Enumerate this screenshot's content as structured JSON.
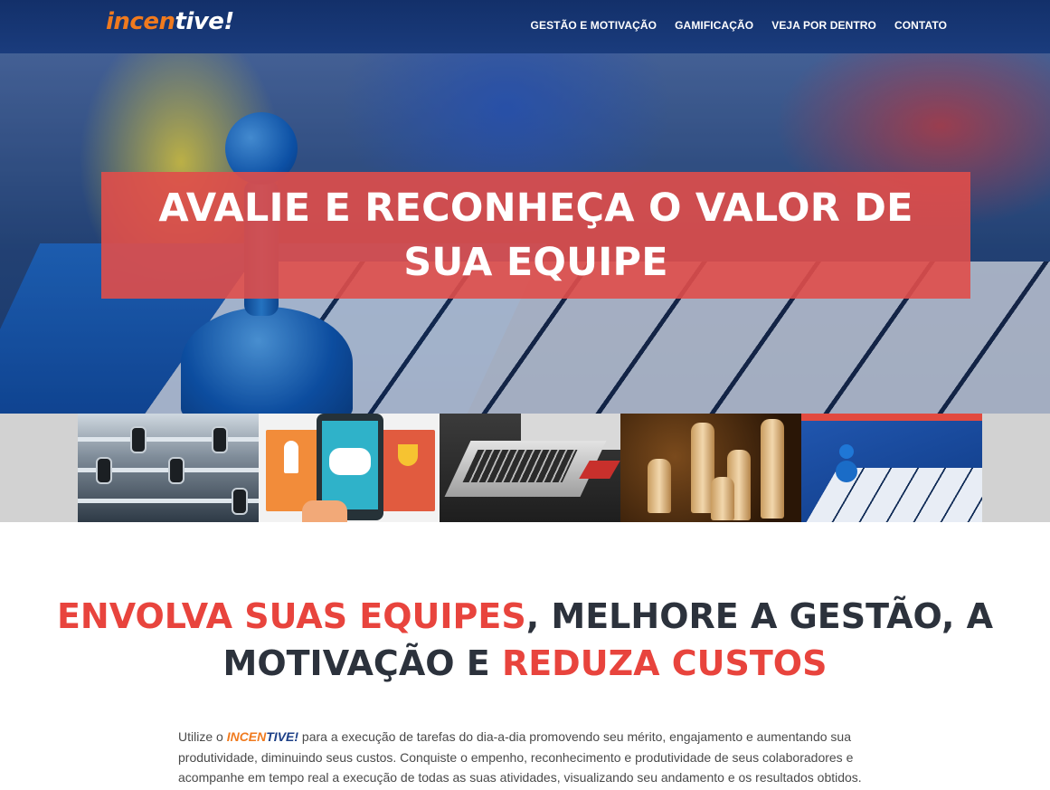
{
  "header": {
    "logo": {
      "part1": "incen",
      "part2": "tive!"
    },
    "nav": [
      {
        "label": "GESTÃO E MOTIVAÇÃO"
      },
      {
        "label": "GAMIFICAÇÃO"
      },
      {
        "label": "VEJA POR DENTRO"
      },
      {
        "label": "CONTATO"
      }
    ]
  },
  "hero": {
    "title": "AVALIE E RECONHEÇA O VALOR DE SUA EQUIPE"
  },
  "thumbnails": [
    {
      "icon": "foosball-image"
    },
    {
      "icon": "gamification-app-image"
    },
    {
      "icon": "laptop-image"
    },
    {
      "icon": "chess-image"
    },
    {
      "icon": "board-game-image",
      "active": true
    }
  ],
  "headline": {
    "part1": "ENVOLVA SUAS EQUIPES",
    "part2": ", MELHORE A GESTÃO, A MOTIVAÇÃO E ",
    "part3": "REDUZA CUSTOS"
  },
  "intro": {
    "prefix": "Utilize o ",
    "brand_a": "INCEN",
    "brand_b": "TIVE!",
    "text": " para a execução de tarefas do dia-a-dia promovendo seu mérito, engajamento e aumentando sua produtividade, diminuindo seus custos. Conquiste o empenho, reconhecimento e produtividade de seus colaboradores e acompanhe em tempo real a execução de todas as suas atividades, visualizando seu andamento e os resultados obtidos."
  },
  "colors": {
    "header_bg": "#13306a",
    "accent_red": "#e8443d",
    "banner_red": "#e04e4a",
    "logo_orange": "#f07a1e",
    "headline_dark": "#2c323c"
  }
}
